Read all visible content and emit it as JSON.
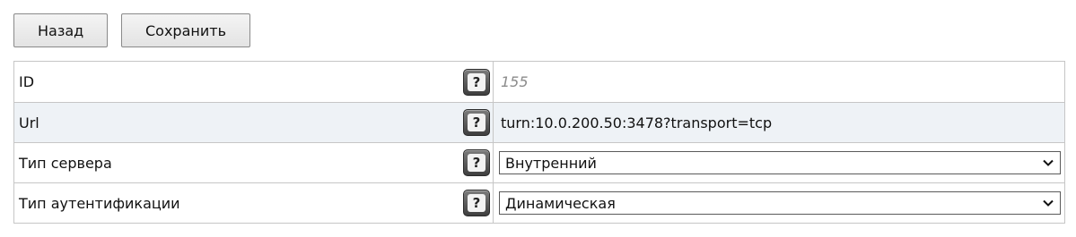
{
  "toolbar": {
    "back_label": "Назад",
    "save_label": "Сохранить"
  },
  "form": {
    "rows": [
      {
        "label": "ID",
        "help": "?",
        "value": "155",
        "kind": "readonly"
      },
      {
        "label": "Url",
        "help": "?",
        "value": "turn:10.0.200.50:3478?transport=tcp",
        "kind": "text"
      },
      {
        "label": "Тип сервера",
        "help": "?",
        "value": "Внутренний",
        "kind": "select"
      },
      {
        "label": "Тип аутентификации",
        "help": "?",
        "value": "Динамическая",
        "kind": "select"
      }
    ]
  },
  "icons": {
    "help": "help-question-icon",
    "dropdown": "chevron-down-icon"
  },
  "colors": {
    "shaded_row": "#eef2f6",
    "border": "#c6c6c6",
    "muted_value": "#8c8c8c"
  }
}
